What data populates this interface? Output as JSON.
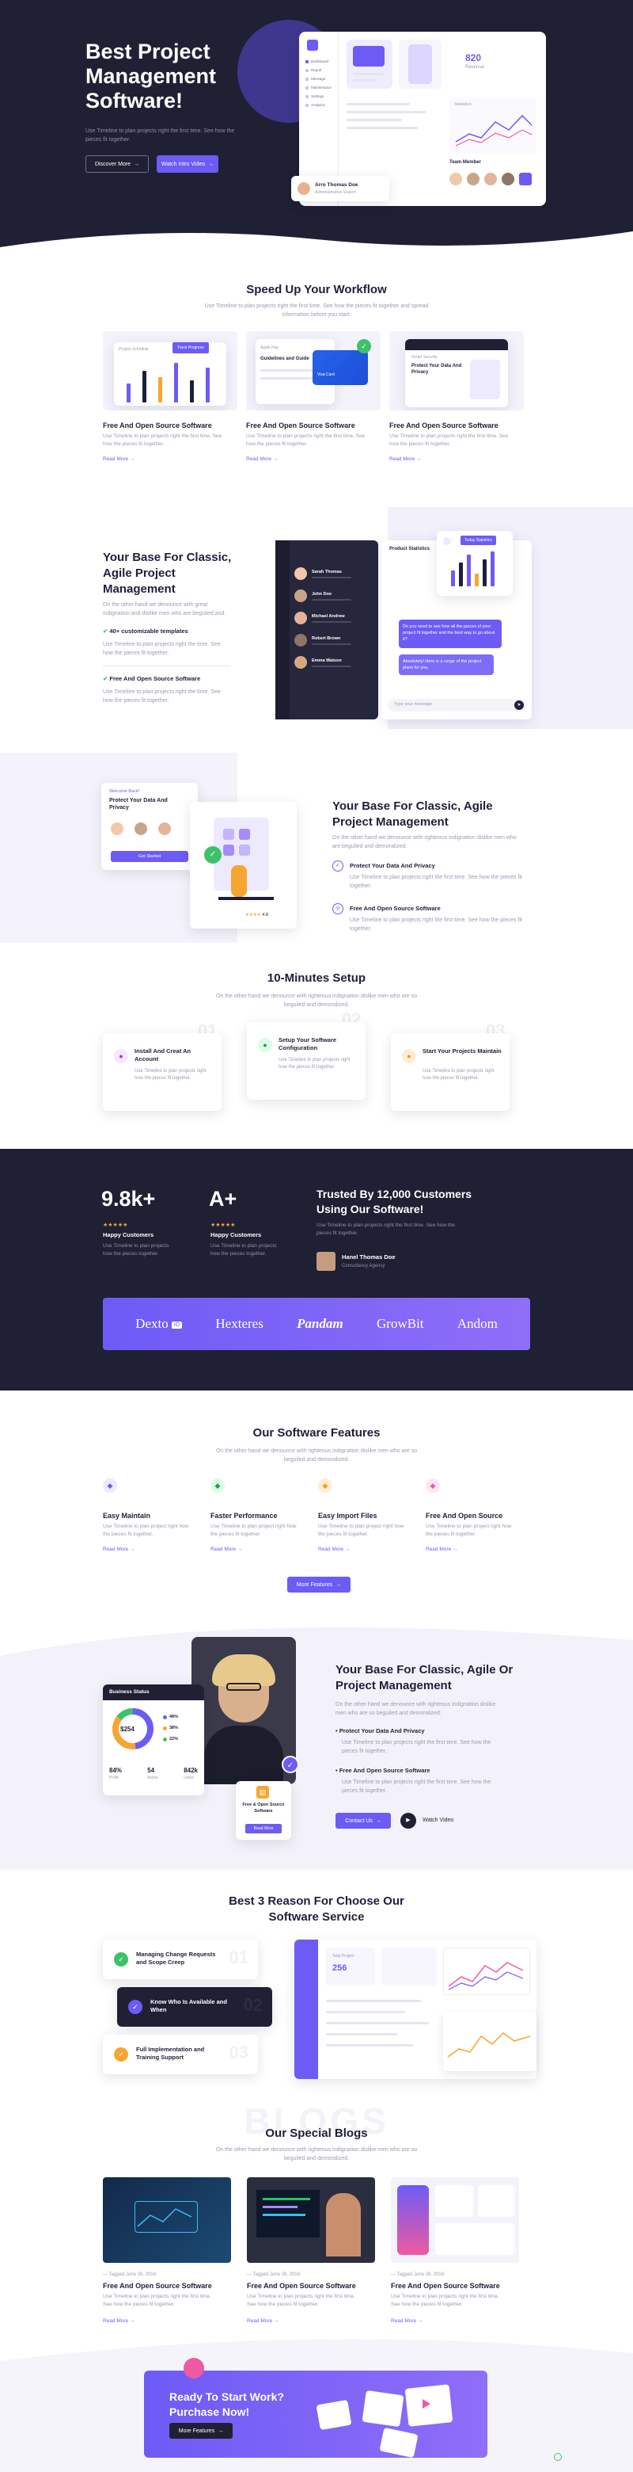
{
  "hero": {
    "title": "Best Project Management Software!",
    "description": "Use Timeline to plan projects right the first time. See how the pieces fit together.",
    "discover_label": "Discover More",
    "watch_label": "Watch Intro Video",
    "mock": {
      "profile_name": "Arro Thomas Doe",
      "profile_role": "Administrative Expert",
      "sidebar_items": [
        "Dashboard",
        "Report",
        "Message",
        "Maintenance",
        "Settings",
        "Analytics"
      ],
      "stat_value": "820",
      "stat_label": "Revenue",
      "team_title": "Team Member",
      "chart_title": "Statistics"
    }
  },
  "workflow": {
    "title": "Speed Up Your Workflow",
    "subtitle": "Use Timeline to plan projects right the first time. See how the pieces fit together and spread information before you start.",
    "cards": [
      {
        "title": "Free And Open Source Software",
        "text": "Use Timeline to plan projects right the first time. See how the pieces fit together.",
        "read_more": "Read More",
        "mock_label": "Project Schedule",
        "mock_btn": "Track Progress",
        "mock_caption": "Plan Monthly"
      },
      {
        "title": "Free And Open Source Software",
        "text": "Use Timeline to plan projects right the first time. See how the pieces fit together.",
        "read_more": "Read More",
        "mock_label": "Apple Pay",
        "mock_caption": "Guidelines and Guide",
        "mock_sub": "Visa Card"
      },
      {
        "title": "Free And Open Source Software",
        "text": "Use Timeline to plan projects right the first time. See how the pieces fit together.",
        "read_more": "Read More",
        "mock_label": "Protect Your Data And Privacy",
        "mock_caption": "Smart Security"
      }
    ]
  },
  "base1": {
    "title": "Your Base For Classic, Agile Project Management",
    "text": "On the other hand we denounce with great indignation and dislike men who are beguiled and.",
    "bullets": [
      {
        "label": "40+ customizable templates",
        "text": "Use Timeline to plan projects right the time. See how the pieces fit together."
      },
      {
        "label": "Free And Open Source Software",
        "text": "Use Timeline to plan projects right the time. See how the pieces fit together."
      }
    ],
    "chat_names": [
      "Sarah Thomas",
      "John Doe",
      "Michael Andrew",
      "Robert Brown",
      "Emma Watson"
    ],
    "chat_message": "Do you need to see how all the pieces of your project fit together and the best way to go about it?",
    "chat_reply": "Absolutely! Here is a range of the project plans for you.",
    "chat_placeholder": "Type your message",
    "report_label": "Product Statistics",
    "report_btn": "Today Statistics"
  },
  "base2": {
    "title": "Your Base For Classic, Agile Project Management",
    "text": "On the other hand we denounce with righteous indignation dislike men who are beguiled and demoralized.",
    "features": [
      {
        "title": "Protect Your Data And Privacy",
        "text": "Use Timeline to plan projects right the first time. See how the pieces fit together."
      },
      {
        "title": "Free And Open Source Software",
        "text": "Use Timeline to plan projects right the first time. See how the pieces fit together."
      }
    ],
    "mock_heading": "Protect Your Data And Privacy",
    "mock_small": "Welcome Back!",
    "mock_btn": "Get Started",
    "mock_rating": "4.8"
  },
  "setup": {
    "title": "10-Minutes Setup",
    "subtitle": "On the other hand we denounce with righteous indignation dislike men who are so beguiled and demoralized.",
    "steps": [
      {
        "num": "01",
        "title": "Install And Creat An Account",
        "text": "Use Timeline to plan projects right how the pieces fit together."
      },
      {
        "num": "02",
        "title": "Setup Your Software Configuration",
        "text": "Use Timeline to plan projects right how the pieces fit together."
      },
      {
        "num": "03",
        "title": "Start Your Projects Maintain",
        "text": "Use Timeline to plan projects right how the pieces fit together."
      }
    ]
  },
  "stats": {
    "stat1_value": "9.8k+",
    "stat1_label": "Happy Customers",
    "stat1_text": "Use Timeline to plan projects how the pieces together.",
    "stat2_value": "A+",
    "stat2_label": "Happy Customers",
    "stat2_text": "Use Timeline to plan projects how the pieces together.",
    "stars": "★★★★★",
    "trusted_title": "Trusted By 12,000 Customers Using Our Software!",
    "trusted_text": "Use Timeline to plan projects right the first time. See how the pieces fit together.",
    "person_name": "Hanel Thomas Doe",
    "person_role": "Consultancy Agency",
    "logos": [
      "Dexto",
      "Hexteres",
      "Pandam",
      "GrowBit",
      "Andom"
    ],
    "logo_badge": "IO"
  },
  "features": {
    "title": "Our Software Features",
    "subtitle": "On the other hand we denounce with righteous indignation dislike men who are so beguiled and demoralized.",
    "items": [
      {
        "title": "Easy Maintain",
        "text": "Use Timeline to plan project right how the pieces fit together.",
        "read_more": "Read More"
      },
      {
        "title": "Faster Performance",
        "text": "Use Timeline to plan project right how the pieces fit together.",
        "read_more": "Read More"
      },
      {
        "title": "Easy Import Files",
        "text": "Use Timeline to plan project right how the pieces fit together.",
        "read_more": "Read More"
      },
      {
        "title": "Free And Open Source",
        "text": "Use Timeline to plan project right how the pieces fit together.",
        "read_more": "Read More"
      }
    ],
    "all_label": "More Features"
  },
  "orproject": {
    "title": "Your Base For Classic, Agile Or Project Management",
    "text": "On the other hand we denounce with righteous indignation dislike men who are so beguiled and demoralized.",
    "bullets": [
      {
        "label": "Protect Your Data And Privacy",
        "text": "Use Timeline to plan projects right the first time. See how the pieces fit together."
      },
      {
        "label": "Free And Open Source Software",
        "text": "Use Timeline to plan projects right the first time. See how the pieces fit together."
      }
    ],
    "contact_label": "Contact Us",
    "watch_label": "Watch Video",
    "dash_title": "Business Status",
    "donut_value": "$254",
    "stats": [
      {
        "value": "84%",
        "label": "Profit"
      },
      {
        "value": "54",
        "label": "Active"
      },
      {
        "value": "842k",
        "label": "Users"
      }
    ],
    "legend": [
      "48%",
      "38%",
      "22%"
    ],
    "popup_text": "Free & Open Source Software",
    "popup_btn": "Read More"
  },
  "reasons": {
    "title": "Best 3 Reason For Choose Our Software Service",
    "items": [
      {
        "title": "Managing Change Requests and Scope Creep",
        "num": "01"
      },
      {
        "title": "Know Who Is Available and When",
        "num": "02"
      },
      {
        "title": "Full Implementation and Training Support",
        "num": "03"
      }
    ],
    "dash_value": "256",
    "dash_label": "Total Project"
  },
  "blogs": {
    "watermark": "BLOGS",
    "title": "Our Special Blogs",
    "subtitle": "On the other hand we denounce with righteous indignation dislike men who are so beguiled and demoralized.",
    "items": [
      {
        "date": "Tagged June 26, 2016",
        "title": "Free And Open Source Software",
        "text": "Use Timeline to plan projects right the first time. See how the pieces fit together.",
        "read_more": "Read More"
      },
      {
        "date": "Tagged June 26, 2016",
        "title": "Free And Open Source Software",
        "text": "Use Timeline to plan projects right the first time. See how the pieces fit together.",
        "read_more": "Read More"
      },
      {
        "date": "Tagged June 26, 2016",
        "title": "Free And Open Source Software",
        "text": "Use Timeline to plan projects right the first time. See how the pieces fit together.",
        "read_more": "Read More"
      }
    ]
  },
  "cta": {
    "title": "Ready To Start Work? Purchase Now!",
    "button": "More Features"
  },
  "colors": {
    "primary": "#6d5bf6",
    "dark": "#1f2034",
    "text": "#1e1f3b",
    "muted": "#9a9cb2",
    "green": "#3dc26b",
    "orange": "#f7a531",
    "pink": "#ee5aa1"
  }
}
